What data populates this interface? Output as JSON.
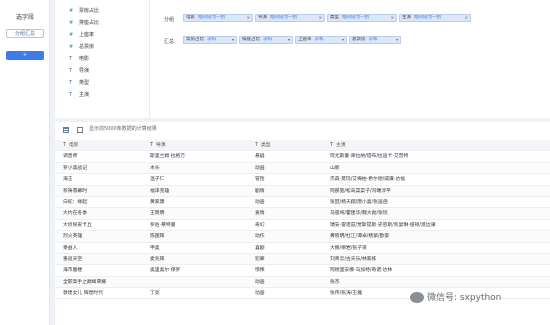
{
  "left": {
    "title": "选字段",
    "btn_group": "分组汇总",
    "btn_plus": "+"
  },
  "fields": [
    {
      "type": "#",
      "label": "票房占比"
    },
    {
      "type": "#",
      "label": "排座占比"
    },
    {
      "type": "#",
      "label": "上座率"
    },
    {
      "type": "#",
      "label": "总票房"
    },
    {
      "type": "T",
      "label": "电影"
    },
    {
      "type": "T",
      "label": "导演"
    },
    {
      "type": "T",
      "label": "类型"
    },
    {
      "type": "T",
      "label": "主演"
    }
  ],
  "config": {
    "group_label": "分组",
    "summary_label": "汇总",
    "group_chips": [
      {
        "name": "电影",
        "sub": "相同值为一组"
      },
      {
        "name": "导演",
        "sub": "相同值为一组"
      },
      {
        "name": "类型",
        "sub": "相同值为一组"
      },
      {
        "name": "主演",
        "sub": "相同值为一组"
      }
    ],
    "summary_chips": [
      {
        "name": "票房占比",
        "sub": "求和"
      },
      {
        "name": "排座占比",
        "sub": "求和"
      },
      {
        "name": "上座率",
        "sub": "求和"
      },
      {
        "name": "总票房",
        "sub": "求和"
      }
    ]
  },
  "table": {
    "notice": "显示前5000条数据的计算结果",
    "columns": [
      {
        "type": "T",
        "label": "电影"
      },
      {
        "type": "T",
        "label": "导演"
      },
      {
        "type": "T",
        "label": "类型"
      },
      {
        "type": "T",
        "label": "主演"
      }
    ],
    "rows": [
      [
        "调音师",
        "斯里兰姆·拉格万",
        "悬疑",
        "阿尤斯曼·库拉纳/塔布/拉迪卡·艾普特"
      ],
      [
        "罗小黑战记",
        "木头",
        "动画",
        "山新"
      ],
      [
        "海王",
        "温子仁",
        "冒险",
        "杰森·莫玛/艾梅柏·希尔德/威廉·达福"
      ],
      [
        "祈祷落幕时",
        "福泽克雄",
        "剧情",
        "阿部宽/松岛菜菜子/沟端淳平"
      ],
      [
        "白蛇：缘起",
        "黄家康",
        "动画",
        "张喆/杨天翔/唐小喜/张遥函"
      ],
      [
        "大约在冬季",
        "王晓明",
        "爱情",
        "马思纯/霍建华/魏大勋/张瑶"
      ],
      [
        "大侦探皮卡丘",
        "罗伯·莱特曼",
        "奇幻",
        "瑞安·雷诺兹/贾斯提斯·史密斯/凯瑟琳·纽顿/渡边谦"
      ],
      [
        "烈火英雄",
        "陈国辉",
        "动作",
        "黄晓明/杜江/谭卓/杨紫/欧豪"
      ],
      [
        "受益人",
        "申奥",
        "喜剧",
        "大鹏/柳岩/张子贤"
      ],
      [
        "重返天空",
        "麦兆辉",
        "犯罪",
        "刘青云/古天乐/林家栋"
      ],
      [
        "海市蜃楼",
        "奥里奥尔·保罗",
        "惊悚",
        "阿德里安娜·乌加特/奇诺·达林"
      ],
      [
        "全职高手之巅峰荣耀",
        "",
        "动画",
        "张杰"
      ],
      [
        "敦煌女儿 辉煌时代",
        "丁亮",
        "动画",
        "张伟/张涛/王雅"
      ]
    ]
  },
  "watermark": "微信号: sxpython"
}
